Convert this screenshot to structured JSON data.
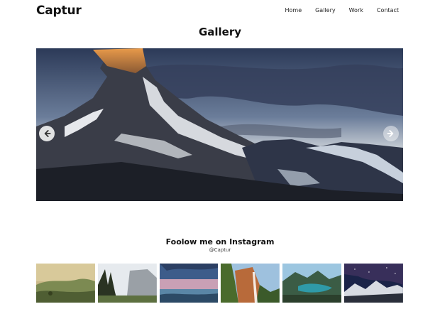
{
  "header": {
    "logo": "Captur",
    "nav": [
      {
        "label": "Home"
      },
      {
        "label": "Gallery"
      },
      {
        "label": "Work"
      },
      {
        "label": "Contact"
      }
    ]
  },
  "main": {
    "title": "Gallery",
    "slider": {
      "current_image": "matterhorn-mountain-at-sunset",
      "prev_icon": "arrow-left-circle-icon",
      "next_icon": "arrow-right-circle-icon"
    }
  },
  "instagram": {
    "title": "Foolow me on Instagram",
    "handle": "@Captur",
    "thumbnails": [
      {
        "subject": "misty-hills"
      },
      {
        "subject": "forest-cliffs"
      },
      {
        "subject": "pink-sunset-sea"
      },
      {
        "subject": "waterfall-canyon"
      },
      {
        "subject": "mountain-lake"
      },
      {
        "subject": "night-sky-mountains"
      }
    ]
  },
  "colors": {
    "background": "#ffffff",
    "text": "#111111",
    "muted": "#444444"
  }
}
